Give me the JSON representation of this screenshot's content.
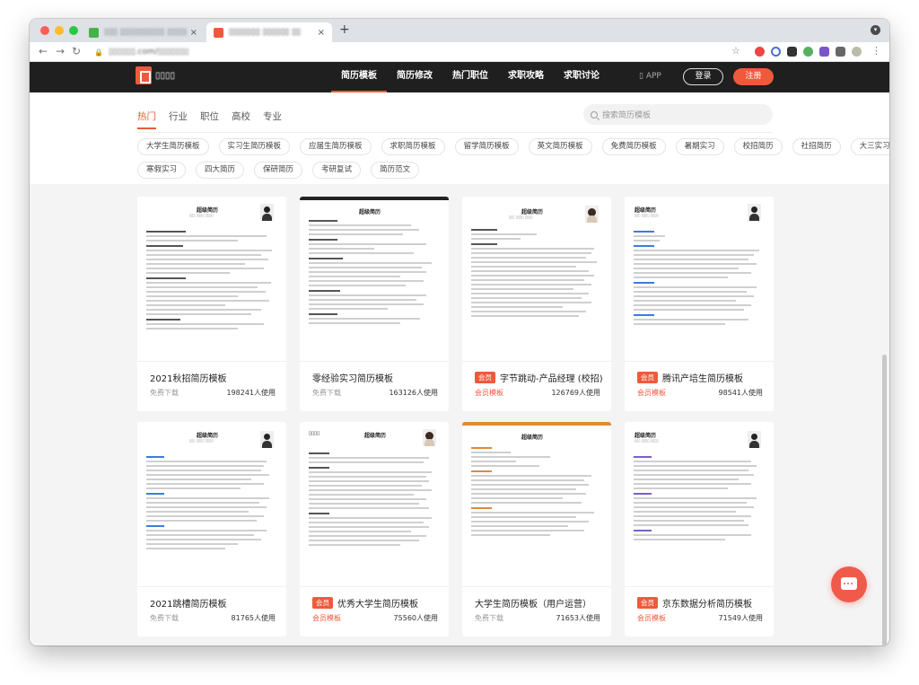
{
  "browser": {
    "tabs": [
      {
        "title": "▯▯▯ ▯▯▯▯▯▯▯▯▯▯ ▯▯▯▯▯▯▯",
        "close": "×"
      },
      {
        "title": "▯▯▯▯▯▯▯ ▯▯▯▯▯▯ ▯▯",
        "close": "×"
      }
    ],
    "new_tab": "+",
    "url": "▯▯▯▯▯▯.com/▯▯▯▯▯▯▯",
    "colors": {
      "favicon1": "#46b34a",
      "favicon2": "#ef5a3c"
    }
  },
  "header": {
    "logo_text": "▯▯▯▯",
    "nav": [
      "简历模板",
      "简历修改",
      "热门职位",
      "求职攻略",
      "求职讨论"
    ],
    "app": "APP",
    "login": "登录",
    "register": "注册"
  },
  "filters": {
    "categories": [
      "热门",
      "行业",
      "职位",
      "高校",
      "专业"
    ],
    "search_placeholder": "搜索简历模板",
    "tags_row1": [
      "大学生简历模板",
      "实习生简历模板",
      "应届生简历模板",
      "求职简历模板",
      "留学简历模板",
      "英文简历模板",
      "免费简历模板",
      "暑期实习",
      "校招简历",
      "社招简历",
      "大三实习"
    ],
    "tags_row2": [
      "寒假实习",
      "四大简历",
      "保研简历",
      "考研复试",
      "简历范文"
    ]
  },
  "cards": [
    {
      "title": "2021秋招简历模板",
      "badge": "",
      "download": "免费下载",
      "uses": "198241人使用"
    },
    {
      "title": "零经验实习简历模板",
      "badge": "",
      "download": "免费下载",
      "uses": "163126人使用"
    },
    {
      "title": "字节跳动-产品经理 (校招) 简历",
      "badge": "会员",
      "download": "会员模板",
      "uses": "126769人使用"
    },
    {
      "title": "腾讯产培生简历模板",
      "badge": "会员",
      "download": "会员模板",
      "uses": "98541人使用"
    },
    {
      "title": "2021跳槽简历模板",
      "badge": "",
      "download": "免费下载",
      "uses": "81765人使用"
    },
    {
      "title": "优秀大学生简历模板",
      "badge": "会员",
      "download": "会员模板",
      "uses": "75560人使用"
    },
    {
      "title": "大学生简历模板（用户运营）",
      "badge": "",
      "download": "免费下载",
      "uses": "71653人使用"
    },
    {
      "title": "京东数据分析简历模板",
      "badge": "会员",
      "download": "会员模板",
      "uses": "71549人使用"
    }
  ],
  "thumb_name": "超级简历",
  "accent": "#ef5a3c",
  "icons": [
    "chat-icon",
    "search-icon",
    "lock-icon",
    "phone-icon"
  ]
}
